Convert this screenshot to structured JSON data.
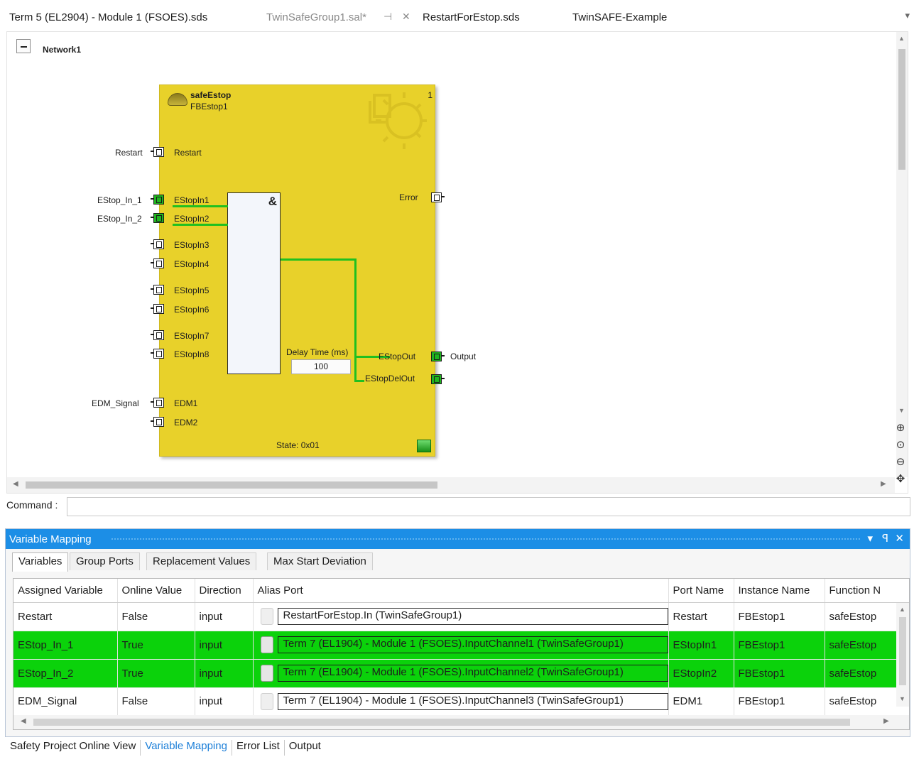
{
  "doc_tabs": [
    {
      "label": "Term 5 (EL2904) - Module 1 (FSOES).sds"
    },
    {
      "label": "TwinSafeGroup1.sal*"
    },
    {
      "label": "RestartForEstop.sds"
    },
    {
      "label": "TwinSAFE-Example"
    }
  ],
  "icons": {
    "pin": "pin-icon",
    "close": "close-icon",
    "overflow": "dropdown-icon"
  },
  "network": {
    "title": "Network1"
  },
  "fblock": {
    "type": "safeEstop",
    "instance": "FBEstop1",
    "number": "1",
    "state": "State: 0x01",
    "and_symbol": "&",
    "delay_label": "Delay Time (ms)",
    "delay_value": "100",
    "inputs": [
      {
        "name": "Restart",
        "external": "Restart",
        "connected": false
      },
      {
        "name": "EStopIn1",
        "external": "EStop_In_1",
        "connected": true
      },
      {
        "name": "EStopIn2",
        "external": "EStop_In_2",
        "connected": true
      },
      {
        "name": "EStopIn3",
        "external": "",
        "connected": false
      },
      {
        "name": "EStopIn4",
        "external": "",
        "connected": false
      },
      {
        "name": "EStopIn5",
        "external": "",
        "connected": false
      },
      {
        "name": "EStopIn6",
        "external": "",
        "connected": false
      },
      {
        "name": "EStopIn7",
        "external": "",
        "connected": false
      },
      {
        "name": "EStopIn8",
        "external": "",
        "connected": false
      },
      {
        "name": "EDM1",
        "external": "EDM_Signal",
        "connected": false
      },
      {
        "name": "EDM2",
        "external": "",
        "connected": false
      }
    ],
    "outputs": [
      {
        "name": "Error",
        "external": "",
        "connected": false
      },
      {
        "name": "EStopOut",
        "external": "Output",
        "connected": true
      },
      {
        "name": "EStopDelOut",
        "external": "",
        "connected": true
      }
    ]
  },
  "command": {
    "label": "Command :",
    "value": ""
  },
  "panel": {
    "title": "Variable Mapping",
    "controls": {
      "dropdown": "▾",
      "pin": "ꟼ",
      "close": "✕"
    },
    "tabs": [
      "Variables",
      "Group Ports",
      "Replacement Values",
      "Max Start Deviation"
    ],
    "active_tab": "Variables",
    "columns": [
      "Assigned Variable",
      "Online Value",
      "Direction",
      "Alias Port",
      "Port Name",
      "Instance Name",
      "Function N"
    ],
    "rows": [
      {
        "variable": "Restart",
        "online": "False",
        "direction": "input",
        "alias": "RestartForEstop.In (TwinSafeGroup1)",
        "port": "Restart",
        "instance": "FBEstop1",
        "function": "safeEstop",
        "active": false
      },
      {
        "variable": "EStop_In_1",
        "online": "True",
        "direction": "input",
        "alias": "Term 7 (EL1904) - Module 1 (FSOES).InputChannel1 (TwinSafeGroup1)",
        "port": "EStopIn1",
        "instance": "FBEstop1",
        "function": "safeEstop",
        "active": true
      },
      {
        "variable": "EStop_In_2",
        "online": "True",
        "direction": "input",
        "alias": "Term 7 (EL1904) - Module 1 (FSOES).InputChannel2 (TwinSafeGroup1)",
        "port": "EStopIn2",
        "instance": "FBEstop1",
        "function": "safeEstop",
        "active": true
      },
      {
        "variable": "EDM_Signal",
        "online": "False",
        "direction": "input",
        "alias": "Term 7 (EL1904) - Module 1 (FSOES).InputChannel3 (TwinSafeGroup1)",
        "port": "EDM1",
        "instance": "FBEstop1",
        "function": "safeEstop",
        "active": false
      }
    ],
    "colors": {
      "active_row": "#0bd20b",
      "title_bar": "#1c8ee6"
    }
  },
  "bottom_tabs": [
    "Safety Project Online View",
    "Variable Mapping",
    "Error List",
    "Output"
  ],
  "bottom_active": "Variable Mapping"
}
